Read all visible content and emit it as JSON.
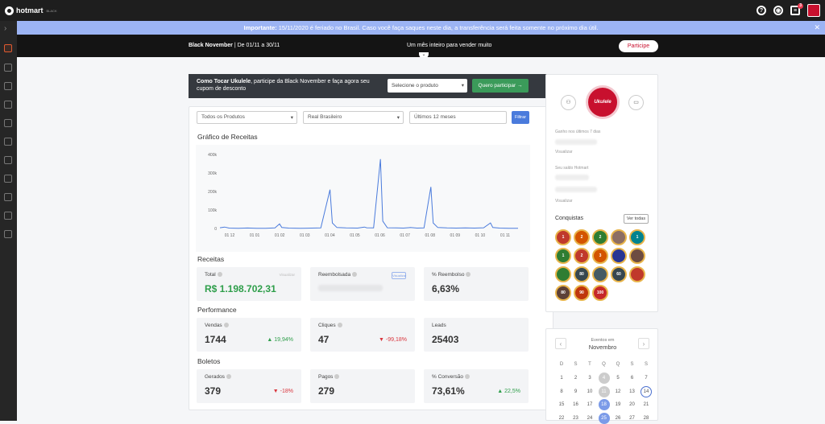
{
  "topbar": {
    "brand": "hotmart",
    "brand_sub": "BLACK",
    "notification_count": "3"
  },
  "notice": {
    "bold": "Importante:",
    "text": "15/11/2020 é feriado no Brasil. Caso você faça saques neste dia, a transferência será feita somente no próximo dia útil.",
    "close": "✕"
  },
  "banner": {
    "title": "Black November",
    "dates": "| De 01/11 a 30/11",
    "tagline": "Um mês inteiro para vender muito",
    "cta": "Participe"
  },
  "promo": {
    "bold": "Como Tocar Ukulele",
    "text": ", participe da Black November e faça agora seu cupom de desconto",
    "select_placeholder": "Selecione o produto",
    "cta": "Quero participar →"
  },
  "filters": {
    "product": "Todos os Produtos",
    "currency": "Real Brasileiro",
    "period": "Últimos 12 meses",
    "button": "Filtrar"
  },
  "sections": {
    "chart": "Gráfico de Receitas",
    "revenue": "Receitas",
    "performance": "Performance",
    "boletos": "Boletos"
  },
  "chart_data": {
    "type": "line",
    "title": "Gráfico de Receitas",
    "y_ticks": [
      "400k",
      "300k",
      "200k",
      "100k",
      "0"
    ],
    "ylim": [
      0,
      400000
    ],
    "x_ticks": [
      "01 12",
      "01 01",
      "01 02",
      "01 03",
      "01 04",
      "01 05",
      "01 06",
      "01 07",
      "01 08",
      "01 09",
      "01 10",
      "01 11"
    ],
    "color": "#4a7bdc",
    "series": [
      {
        "points": [
          [
            0,
            4000
          ],
          [
            2,
            8000
          ],
          [
            4,
            2000
          ],
          [
            8,
            1500
          ],
          [
            12,
            2500
          ],
          [
            16,
            1000
          ],
          [
            20,
            1500
          ],
          [
            24,
            3000
          ],
          [
            26,
            25000
          ],
          [
            27,
            5000
          ],
          [
            30,
            2000
          ],
          [
            35,
            1500
          ],
          [
            40,
            2000
          ],
          [
            44,
            3000
          ],
          [
            48,
            210000
          ],
          [
            49,
            30000
          ],
          [
            51,
            5000
          ],
          [
            55,
            3000
          ],
          [
            60,
            2000
          ],
          [
            63,
            8000
          ],
          [
            64,
            4000
          ],
          [
            67,
            3000
          ],
          [
            70,
            375000
          ],
          [
            71,
            40000
          ],
          [
            73,
            4000
          ],
          [
            77,
            3000
          ],
          [
            80,
            2000
          ],
          [
            83,
            5000
          ],
          [
            86,
            2000
          ],
          [
            89,
            3000
          ],
          [
            92,
            225000
          ],
          [
            93,
            30000
          ],
          [
            95,
            5000
          ],
          [
            99,
            3000
          ],
          [
            103,
            2000
          ],
          [
            107,
            3000
          ],
          [
            111,
            2000
          ],
          [
            115,
            4000
          ],
          [
            118,
            30000
          ],
          [
            119,
            5000
          ],
          [
            122,
            2000
          ],
          [
            126,
            1500
          ],
          [
            130,
            1000
          ]
        ]
      }
    ]
  },
  "receitas": {
    "total": {
      "label": "Total",
      "value": "R$ 1.198.702,31",
      "hint": "Visualizar"
    },
    "reembolsada": {
      "label": "Reembolsada",
      "button": "Visualizar"
    },
    "pct_reembolso": {
      "label": "% Reembolso",
      "value": "6,63%"
    }
  },
  "performance": {
    "vendas": {
      "label": "Vendas",
      "value": "1744",
      "delta": "▲ 19,94%"
    },
    "cliques": {
      "label": "Cliques",
      "value": "47",
      "delta": "▼ -99,18%"
    },
    "leads": {
      "label": "Leads",
      "value": "25403"
    }
  },
  "boletos": {
    "gerados": {
      "label": "Gerados",
      "value": "379",
      "delta": "▼ -18%"
    },
    "pagos": {
      "label": "Pagos",
      "value": "279"
    },
    "conversao": {
      "label": "% Conversão",
      "value": "73,61%",
      "delta": "▲ 22,5%"
    }
  },
  "side": {
    "profile_text": "Ukulele",
    "earned_label": "Ganho nos últimos 7 dias",
    "hide_label": "Visualizar",
    "balance_label": "Seu saldo Hotmart",
    "achievements": "Conquistas",
    "see_all": "Ver todas",
    "medals": [
      "1",
      "2",
      "2",
      "",
      "1",
      "1",
      "2",
      "3",
      "",
      "",
      "",
      "80",
      "",
      "60",
      "",
      "80",
      "90",
      "100"
    ]
  },
  "calendar": {
    "title": "Eventos em",
    "month": "Novembro",
    "prev": "‹",
    "next": "›",
    "weekdays": [
      "D",
      "S",
      "T",
      "Q",
      "Q",
      "S",
      "S"
    ],
    "rows": [
      [
        "1",
        "2",
        "3",
        "4",
        "5",
        "6",
        "7"
      ],
      [
        "8",
        "9",
        "10",
        "11",
        "12",
        "13",
        "14"
      ],
      [
        "15",
        "16",
        "17",
        "18",
        "19",
        "20",
        "21"
      ],
      [
        "22",
        "23",
        "24",
        "25",
        "26",
        "27",
        "28"
      ]
    ]
  },
  "colors": {
    "accent": "#4a7bdc",
    "brand": "#c8102e",
    "green": "#2e9e4a",
    "red": "#d9363e"
  }
}
